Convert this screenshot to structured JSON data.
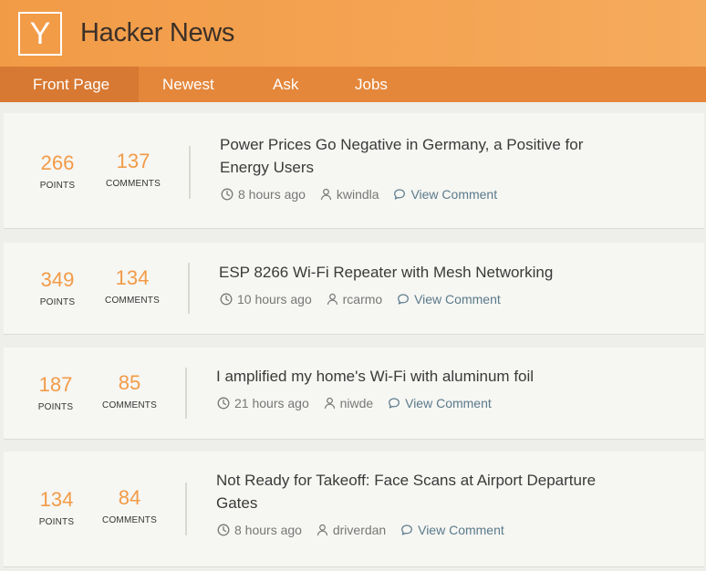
{
  "header": {
    "logo_letter": "Y",
    "title": "Hacker News"
  },
  "nav": {
    "tabs": [
      "Front Page",
      "Newest",
      "Ask",
      "Jobs"
    ],
    "active": "Front Page"
  },
  "labels": {
    "points": "POINTS",
    "comments": "COMMENTS",
    "view_comment": "View Comment"
  },
  "stories": [
    {
      "points": "266",
      "comments": "137",
      "title": "Power Prices Go Negative in Germany, a Positive for Energy Users",
      "age": "8 hours ago",
      "user": "kwindla"
    },
    {
      "points": "349",
      "comments": "134",
      "title": "ESP 8266 Wi-Fi Repeater with Mesh Networking",
      "age": "10 hours ago",
      "user": "rcarmo"
    },
    {
      "points": "187",
      "comments": "85",
      "title": "I amplified my home's Wi-Fi with aluminum foil",
      "age": "21 hours ago",
      "user": "niwde"
    },
    {
      "points": "134",
      "comments": "84",
      "title": "Not Ready for Takeoff: Face Scans at Airport Departure Gates",
      "age": "8 hours ago",
      "user": "driverdan"
    }
  ],
  "colors": {
    "header": "#f4a453",
    "nav": "#e4873b",
    "nav_active": "#d77932",
    "accent_number": "#f29b47",
    "link": "#5a7a8a"
  },
  "icons": {
    "age": "clock-icon",
    "user": "user-icon",
    "comment": "comment-bubble-icon"
  }
}
